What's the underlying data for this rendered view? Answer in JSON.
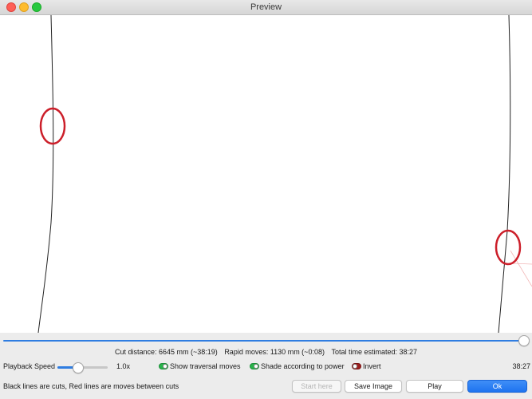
{
  "window": {
    "title": "Preview"
  },
  "stats": {
    "cut_distance": "Cut distance: 6645 mm (~38:19)",
    "rapid_moves": "Rapid moves: 1130 mm (~0:08)",
    "total_time": "Total time estimated: 38:27"
  },
  "playback": {
    "speed_label": "Playback Speed",
    "speed_value": "1.0x",
    "speed_fraction": 0.4,
    "progress_fraction": 1.0,
    "elapsed": "38:27"
  },
  "toggles": {
    "traversal": {
      "label": "Show traversal moves",
      "on": true
    },
    "shade": {
      "label": "Shade according to power",
      "on": true
    },
    "invert": {
      "label": "Invert",
      "on": false
    }
  },
  "footer": {
    "hint": "Black lines are cuts, Red lines are moves between cuts",
    "start_here": "Start here",
    "save_image": "Save Image",
    "play": "Play",
    "ok": "Ok"
  },
  "colors": {
    "accent": "#2f7de1",
    "cut_line": "#222222",
    "move_line": "#f2b8b8",
    "annotation": "#cc1f2a"
  }
}
